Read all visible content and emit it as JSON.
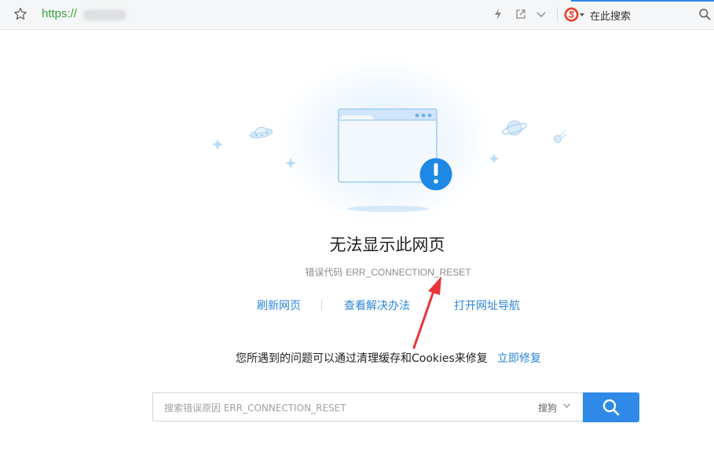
{
  "toolbar": {
    "url": "https://",
    "search_placeholder": "在此搜索",
    "icons": [
      "star-icon",
      "lightning-icon",
      "share-icon",
      "chevron-down-icon",
      "sogou-logo-icon",
      "search-icon"
    ],
    "accent_color": "#2e8ae6",
    "url_color": "#3aa63e"
  },
  "error": {
    "title": "无法显示此网页",
    "code_label": "错误代码",
    "code": "ERR_CONNECTION_RESET"
  },
  "actions": {
    "refresh": "刷新网页",
    "solutions": "查看解决办法",
    "navigation": "打开网址导航"
  },
  "tip": {
    "text": "您所遇到的问题可以通过清理缓存和Cookies来修复",
    "fix_link": "立即修复"
  },
  "search": {
    "placeholder": "搜索错误原因 ERR_CONNECTION_RESET",
    "engine": "搜狗",
    "button_icon": "search-icon",
    "button_color": "#2e8ae6"
  },
  "colors": {
    "link": "#2a86d8",
    "annotation_arrow": "#e8353a",
    "alert_badge": "#1e88e5"
  }
}
